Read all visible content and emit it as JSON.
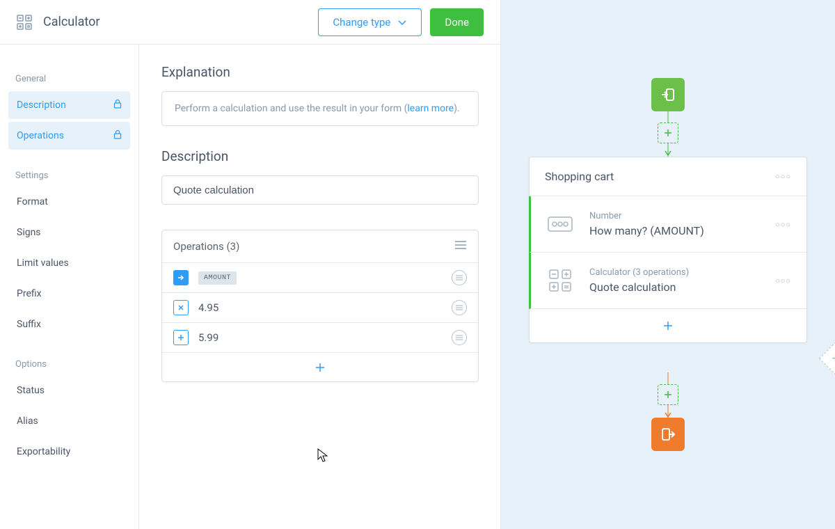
{
  "header": {
    "title": "Calculator",
    "change_type": "Change type",
    "done": "Done"
  },
  "sidebar": {
    "groups": [
      {
        "title": "General",
        "items": [
          {
            "label": "Description",
            "active": true,
            "lock": true
          },
          {
            "label": "Operations",
            "active": true,
            "lock": true
          }
        ]
      },
      {
        "title": "Settings",
        "items": [
          {
            "label": "Format"
          },
          {
            "label": "Signs"
          },
          {
            "label": "Limit values"
          },
          {
            "label": "Prefix"
          },
          {
            "label": "Suffix"
          }
        ]
      },
      {
        "title": "Options",
        "items": [
          {
            "label": "Status"
          },
          {
            "label": "Alias"
          },
          {
            "label": "Exportability"
          }
        ]
      }
    ]
  },
  "main": {
    "explanation_title": "Explanation",
    "explanation_text_pre": "Perform a calculation and use the result in your form (",
    "explanation_link": "learn more",
    "explanation_text_post": ").",
    "description_title": "Description",
    "description_value": "Quote calculation",
    "operations_title": "Operations (3)",
    "ops": [
      {
        "icon": "start",
        "kind": "token",
        "value": "AMOUNT"
      },
      {
        "icon": "multiply",
        "kind": "number",
        "value": "4.95"
      },
      {
        "icon": "plus",
        "kind": "number",
        "value": "5.99"
      }
    ]
  },
  "flow": {
    "card_title": "Shopping cart",
    "items": [
      {
        "type": "Number",
        "label": "How many? (AMOUNT)",
        "icon": "number"
      },
      {
        "type": "Calculator (3 operations)",
        "label": "Quote calculation",
        "icon": "calculator"
      }
    ]
  },
  "colors": {
    "blue": "#2e9df7",
    "green": "#3fbf3f",
    "orange": "#f07b2d"
  }
}
